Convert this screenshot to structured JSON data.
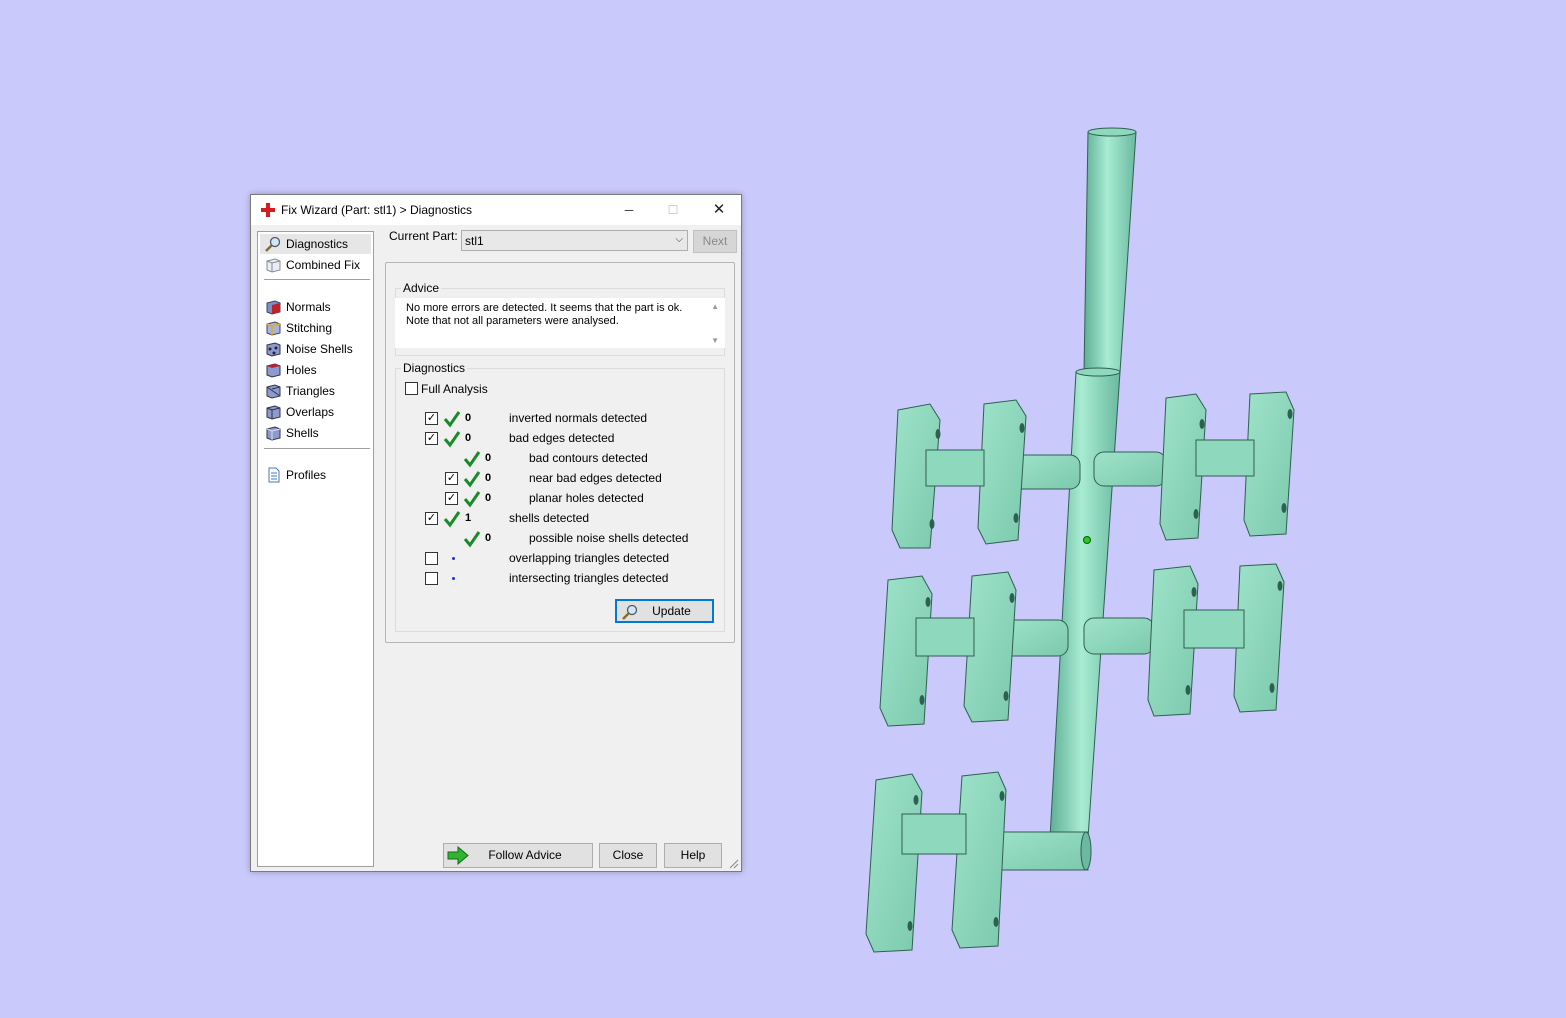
{
  "window": {
    "title": "Fix Wizard (Part: stl1) > Diagnostics",
    "controls": {
      "minimize": "─",
      "maximize": "☐",
      "close": "✕"
    }
  },
  "sidebar": {
    "items": [
      {
        "label": "Diagnostics",
        "icon": "magnifier-icon",
        "selected": true
      },
      {
        "label": "Combined Fix",
        "icon": "cube-icon"
      },
      {
        "label": "Normals",
        "icon": "normals-cube-icon"
      },
      {
        "label": "Stitching",
        "icon": "stitching-cube-icon"
      },
      {
        "label": "Noise Shells",
        "icon": "noise-shells-icon"
      },
      {
        "label": "Holes",
        "icon": "holes-cube-icon"
      },
      {
        "label": "Triangles",
        "icon": "triangles-cube-icon"
      },
      {
        "label": "Overlaps",
        "icon": "overlaps-cube-icon"
      },
      {
        "label": "Shells",
        "icon": "shells-cube-icon"
      },
      {
        "label": "Profiles",
        "icon": "document-icon"
      }
    ]
  },
  "current_part": {
    "label": "Current Part:",
    "value": "stl1"
  },
  "next_button": "Next",
  "advice": {
    "title": "Advice",
    "text": "No more errors are detected. It seems that the part is ok.\nNote that not all parameters were analysed."
  },
  "diagnostics": {
    "title": "Diagnostics",
    "full_analysis": {
      "label": "Full Analysis",
      "checked": false
    },
    "rows": [
      {
        "checked": true,
        "status": "ok",
        "count": "0",
        "label": "inverted normals detected"
      },
      {
        "checked": true,
        "status": "ok",
        "count": "0",
        "label": "bad edges detected"
      },
      {
        "checked": null,
        "status": "ok",
        "count": "0",
        "label": "bad contours detected"
      },
      {
        "checked": true,
        "status": "ok",
        "count": "0",
        "label": "near bad edges detected"
      },
      {
        "checked": true,
        "status": "ok",
        "count": "0",
        "label": "planar holes detected"
      },
      {
        "checked": true,
        "status": "ok",
        "count": "1",
        "label": "shells detected"
      },
      {
        "checked": null,
        "status": "ok",
        "count": "0",
        "label": "possible noise shells detected"
      },
      {
        "checked": false,
        "status": "not-analysed",
        "count": "",
        "label": "overlapping triangles detected"
      },
      {
        "checked": false,
        "status": "not-analysed",
        "count": "",
        "label": "intersecting triangles detected"
      }
    ],
    "update_button": "Update"
  },
  "footer": {
    "follow_advice": "Follow Advice",
    "close": "Close",
    "help": "Help"
  },
  "colors": {
    "background": "#c9c9fb",
    "model": "#8ed8bd",
    "model_shade": "#5fae95",
    "check_green": "#1a8a2a"
  }
}
